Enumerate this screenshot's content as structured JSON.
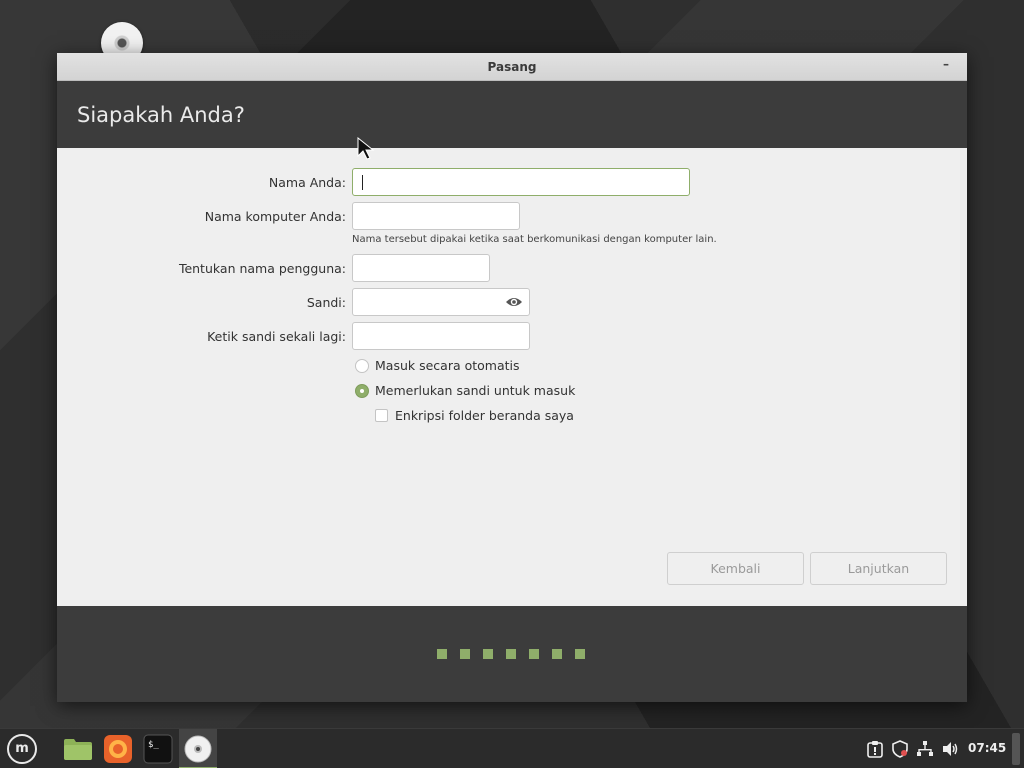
{
  "window": {
    "title": "Pasang",
    "minimize_label": "–"
  },
  "page": {
    "heading": "Siapakah Anda?"
  },
  "form": {
    "name_label": "Nama Anda:",
    "name_value": "",
    "computer_label": "Nama komputer Anda:",
    "computer_value": "",
    "computer_hint": "Nama tersebut dipakai ketika saat berkomunikasi dengan komputer lain.",
    "username_label": "Tentukan nama pengguna:",
    "username_value": "",
    "password_label": "Sandi:",
    "password_value": "",
    "confirm_label": "Ketik sandi sekali lagi:",
    "confirm_value": "",
    "auto_login_label": "Masuk secara otomatis",
    "auto_login_selected": false,
    "require_password_label": "Memerlukan sandi untuk masuk",
    "require_password_selected": true,
    "encrypt_label": "Enkripsi folder beranda saya",
    "encrypt_checked": false
  },
  "buttons": {
    "back_label": "Kembali",
    "continue_label": "Lanjutkan"
  },
  "progress": {
    "total_steps": 7,
    "color": "#8fae6a"
  },
  "taskbar": {
    "menu_icon": "mint-logo-icon",
    "apps": [
      "files-icon",
      "firefox-icon",
      "terminal-icon",
      "installer-disc-icon"
    ],
    "clock": "07:45"
  },
  "colors": {
    "accent": "#8fae6a",
    "header_bg": "#3c3c3c",
    "content_bg": "#efefef"
  }
}
